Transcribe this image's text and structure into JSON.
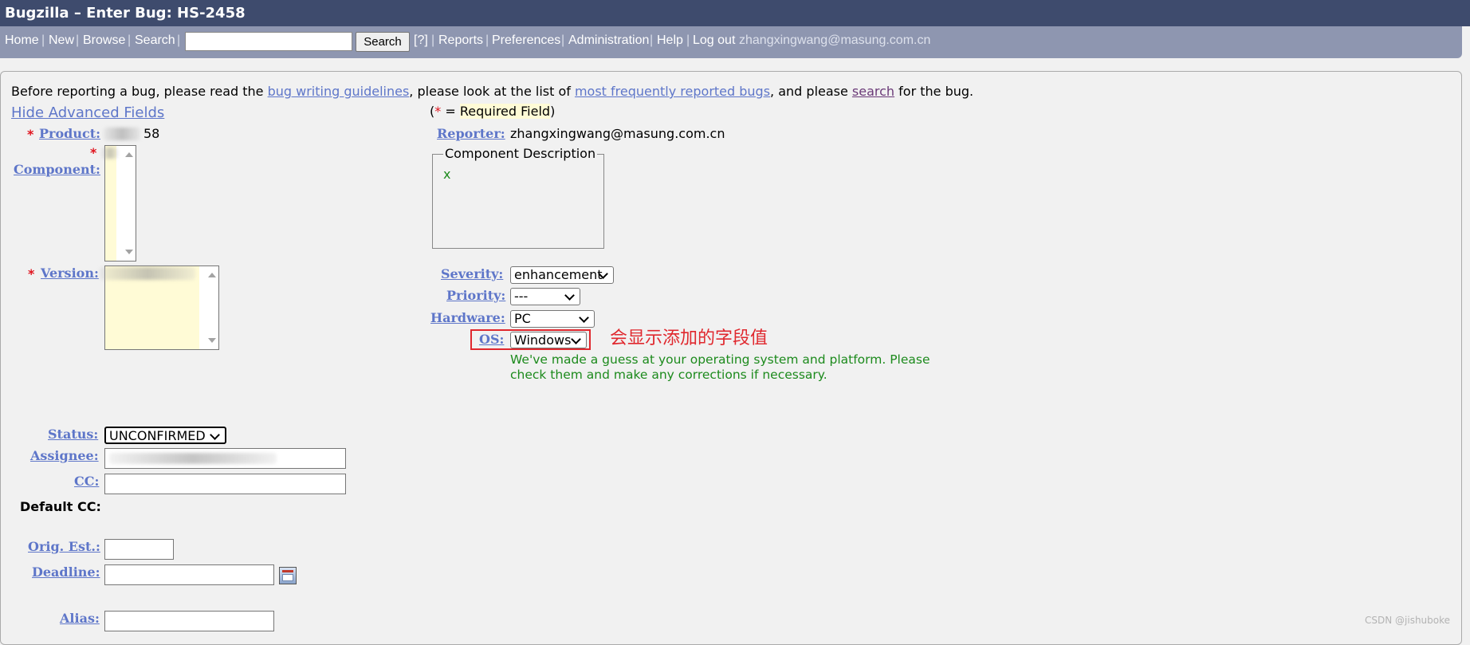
{
  "title": "Bugzilla – Enter Bug: HS-2458",
  "nav": {
    "home": "Home",
    "new": "New",
    "browse": "Browse",
    "search": "Search",
    "sep": "|",
    "search_button": "Search",
    "help_q": "[?]",
    "reports": "Reports",
    "preferences": "Preferences",
    "administration": "Administration",
    "help": "Help",
    "logout": "Log out",
    "user_email": "zhangxingwang@masung.com.cn"
  },
  "intro": {
    "part1": "Before reporting a bug, please read the ",
    "link1": "bug writing guidelines",
    "part2": ", please look at the list of ",
    "link2": "most frequently reported bugs",
    "part3": ", and please ",
    "link3": "search",
    "part4": " for the bug."
  },
  "hide_advanced": "Hide Advanced Fields",
  "required_note": {
    "open": "(",
    "star": "*",
    "eq": " = ",
    "text": "Required Field",
    "close": ")"
  },
  "required_star": "*",
  "labels": {
    "product": "Product:",
    "component": "Component:",
    "version": "Version:",
    "reporter": "Reporter:",
    "severity": "Severity:",
    "priority": "Priority:",
    "hardware": "Hardware:",
    "os": "OS:",
    "status": "Status:",
    "assignee": "Assignee:",
    "cc": "CC:",
    "default_cc": "Default CC:",
    "orig_est": "Orig. Est.:",
    "deadline": "Deadline:",
    "alias": "Alias:"
  },
  "product_value_tail": "58",
  "reporter_value": "zhangxingwang@masung.com.cn",
  "component_description": {
    "legend": "Component Description",
    "text": "x"
  },
  "selects": {
    "severity": "enhancement",
    "priority": "---",
    "hardware": "PC",
    "os": "Windows",
    "status": "UNCONFIRMED"
  },
  "guess_note": "We've made a guess at your operating system and platform. Please check them and make any corrections if necessary.",
  "annotation": "会显示添加的字段值",
  "watermark": "CSDN @jishuboke",
  "colors": {
    "title_bar": "#3e4b6d",
    "nav_bar": "#8e96b0",
    "link": "#5e76c9",
    "required": "#e0141e",
    "note_green": "#1c8a1c",
    "annotation_red": "#e0282e"
  }
}
